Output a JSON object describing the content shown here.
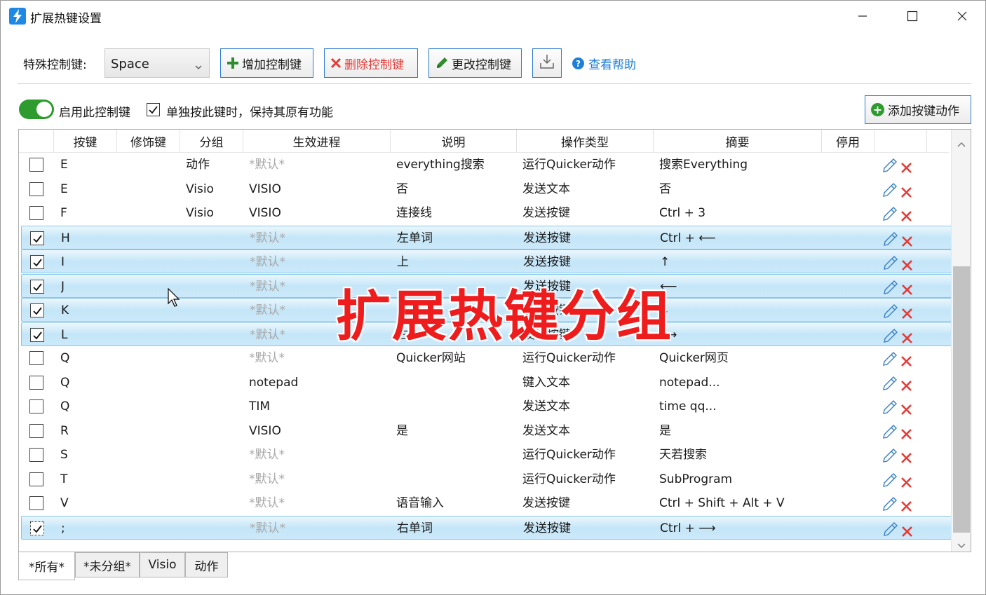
{
  "window": {
    "title": "扩展热键设置",
    "icon": "lightning-icon"
  },
  "toolbar": {
    "special_key_label": "特殊控制键:",
    "special_key_value": "Space",
    "add_label": "增加控制键",
    "delete_label": "删除控制键",
    "edit_label": "更改控制键",
    "help_label": "查看帮助"
  },
  "options": {
    "enable_label": "启用此控制键",
    "enable_on": true,
    "keep_label": "单独按此键时，保持其原有功能",
    "keep_checked": true,
    "add_action_label": "添加按键动作"
  },
  "grid": {
    "columns": [
      "按键",
      "修饰键",
      "分组",
      "生效进程",
      "说明",
      "操作类型",
      "摘要",
      "停用"
    ],
    "rows": [
      {
        "checked": false,
        "key": "E",
        "mod": "",
        "group": "动作",
        "process": "*默认*",
        "desc": "everything搜索",
        "type": "运行Quicker动作",
        "summary": "搜索Everything"
      },
      {
        "checked": false,
        "key": "E",
        "mod": "",
        "group": "Visio",
        "process": "VISIO",
        "desc": "否",
        "type": "发送文本",
        "summary": "否"
      },
      {
        "checked": false,
        "key": "F",
        "mod": "",
        "group": "Visio",
        "process": "VISIO",
        "desc": "连接线",
        "type": "发送按键",
        "summary": "Ctrl + 3"
      },
      {
        "checked": true,
        "key": "H",
        "mod": "",
        "group": "",
        "process": "*默认*",
        "desc": "左单词",
        "type": "发送按键",
        "summary": "Ctrl + ⟵"
      },
      {
        "checked": true,
        "key": "I",
        "mod": "",
        "group": "",
        "process": "*默认*",
        "desc": "上",
        "type": "发送按键",
        "summary": "↑"
      },
      {
        "checked": true,
        "key": "J",
        "mod": "",
        "group": "",
        "process": "*默认*",
        "desc": "",
        "type": "发送按键",
        "summary": "⟵"
      },
      {
        "checked": true,
        "key": "K",
        "mod": "",
        "group": "",
        "process": "*默认*",
        "desc": "",
        "type": "发送按键",
        "summary": "↓"
      },
      {
        "checked": true,
        "key": "L",
        "mod": "",
        "group": "",
        "process": "*默认*",
        "desc": "右",
        "type": "发送按键",
        "summary": "⟶"
      },
      {
        "checked": false,
        "key": "Q",
        "mod": "",
        "group": "",
        "process": "*默认*",
        "desc": "Quicker网站",
        "type": "运行Quicker动作",
        "summary": "Quicker网页"
      },
      {
        "checked": false,
        "key": "Q",
        "mod": "",
        "group": "",
        "process": "notepad",
        "desc": "",
        "type": "键入文本",
        "summary": "notepad..."
      },
      {
        "checked": false,
        "key": "Q",
        "mod": "",
        "group": "",
        "process": "TIM",
        "desc": "",
        "type": "发送文本",
        "summary": "time qq..."
      },
      {
        "checked": false,
        "key": "R",
        "mod": "",
        "group": "",
        "process": "VISIO",
        "desc": "是",
        "type": "发送文本",
        "summary": "是"
      },
      {
        "checked": false,
        "key": "S",
        "mod": "",
        "group": "",
        "process": "*默认*",
        "desc": "",
        "type": "运行Quicker动作",
        "summary": "天若搜索"
      },
      {
        "checked": false,
        "key": "T",
        "mod": "",
        "group": "",
        "process": "*默认*",
        "desc": "",
        "type": "运行Quicker动作",
        "summary": "SubProgram"
      },
      {
        "checked": false,
        "key": "V",
        "mod": "",
        "group": "",
        "process": "*默认*",
        "desc": "语音输入",
        "type": "发送按键",
        "summary": "Ctrl + Shift + Alt + V"
      },
      {
        "checked": true,
        "key": ";",
        "mod": "",
        "group": "",
        "process": "*默认*",
        "desc": "右单词",
        "type": "发送按键",
        "summary": "Ctrl + ⟶"
      }
    ]
  },
  "tabs": [
    "*所有*",
    "*未分组*",
    "Visio",
    "动作"
  ],
  "active_tab": 0,
  "overlay_text": "扩展热键分组",
  "colors": {
    "accent": "#2b7ad0",
    "toggle_on": "#2e9b2e",
    "delete": "#e53935",
    "overlay": "#ee1c1c",
    "selected_row": "#c4e6f8"
  }
}
